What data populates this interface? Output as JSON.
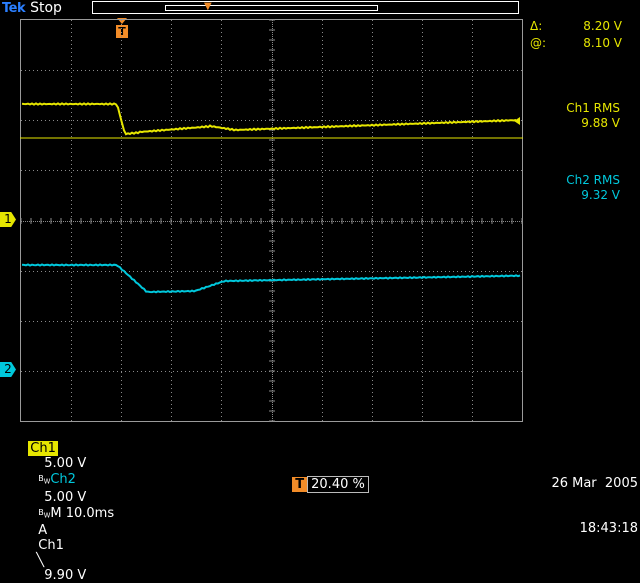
{
  "header": {
    "brand": "Tek",
    "run_state": "Stop"
  },
  "markers": {
    "trigger_marker": "T",
    "ch1_marker": "1",
    "ch2_marker": "2"
  },
  "cursors": {
    "delta_label": "Δ:",
    "delta_value": "8.20 V",
    "at_label": "@:",
    "at_value": "8.10 V"
  },
  "measurements": [
    {
      "label": "Ch1 RMS",
      "value": "9.88 V",
      "color": "#e6e600"
    },
    {
      "label": "Ch2 RMS",
      "value": "9.32 V",
      "color": "#00c8dc"
    }
  ],
  "status": {
    "ch1_label": "Ch1",
    "ch1_scale": "5.00 V",
    "ch2_label": "Ch2",
    "ch2_scale": "5.00 V",
    "timebase": "M 10.0ms",
    "trigger_mode": "A",
    "trigger_source": "Ch1",
    "trigger_slope": "╲",
    "trigger_level": "9.90 V",
    "trigger_position_tag": "T",
    "trigger_position": "20.40 %",
    "date": "26 Mar  2005",
    "time": "18:43:18"
  },
  "colors": {
    "ch1": "#e6e600",
    "ch2": "#00c8dc",
    "trigger": "#f28c28",
    "grid": "#8a8a8a"
  }
}
